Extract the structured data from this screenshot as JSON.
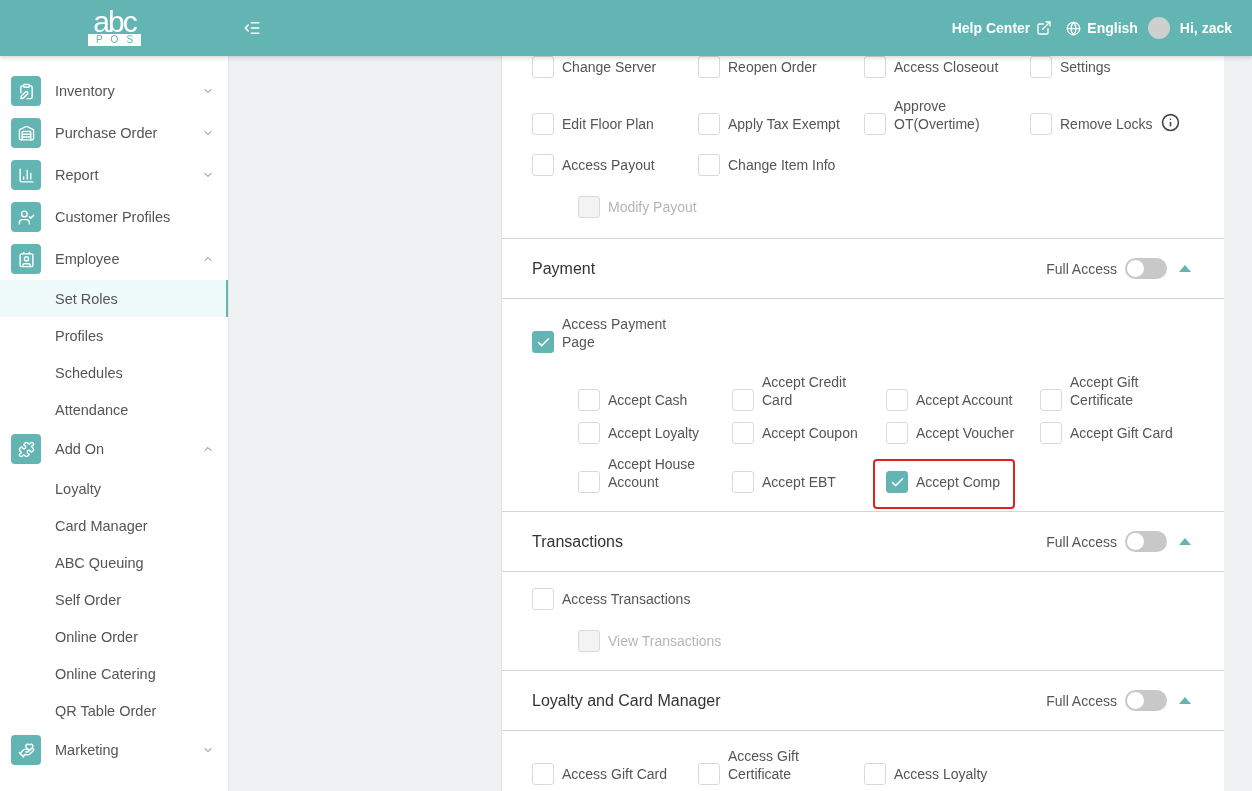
{
  "header": {
    "logo": {
      "wordmark": "abc",
      "sub": "POS"
    },
    "help": "Help Center",
    "language": "English",
    "greeting": "Hi, zack"
  },
  "sidebar": {
    "items": [
      {
        "label": "Inventory",
        "expanded": false
      },
      {
        "label": "Purchase Order",
        "expanded": false
      },
      {
        "label": "Report",
        "expanded": false
      },
      {
        "label": "Customer Profiles"
      },
      {
        "label": "Employee",
        "expanded": true,
        "children": [
          {
            "label": "Set Roles",
            "selected": true
          },
          {
            "label": "Profiles",
            "selected": false
          },
          {
            "label": "Schedules",
            "selected": false
          },
          {
            "label": "Attendance",
            "selected": false
          }
        ]
      },
      {
        "label": "Add On",
        "expanded": true,
        "children": [
          {
            "label": "Loyalty",
            "selected": false
          },
          {
            "label": "Card Manager",
            "selected": false
          },
          {
            "label": "ABC Queuing",
            "selected": false
          },
          {
            "label": "Self Order",
            "selected": false
          },
          {
            "label": "Online Order",
            "selected": false
          },
          {
            "label": "Online Catering",
            "selected": false
          },
          {
            "label": "QR Table Order",
            "selected": false
          }
        ]
      },
      {
        "label": "Marketing",
        "expanded": false
      }
    ]
  },
  "sections": [
    {
      "items": [
        {
          "label": "Change Server",
          "checked": false
        },
        {
          "label": "Reopen Order",
          "checked": false
        },
        {
          "label": "Access Closeout",
          "checked": false
        },
        {
          "label": "Settings",
          "checked": false
        },
        {
          "label": "Edit Floor Plan",
          "checked": false
        },
        {
          "label": "Apply Tax Exempt",
          "checked": false
        },
        {
          "label": "Approve OT(Overtime)",
          "checked": false
        },
        {
          "label": "Remove Locks",
          "checked": false,
          "info": true
        },
        {
          "label": "Access Payout",
          "checked": false,
          "children": [
            {
              "label": "Modify Payout",
              "checked": false,
              "disabled": true
            }
          ]
        },
        {
          "label": "Change Item Info",
          "checked": false
        }
      ]
    },
    {
      "title": "Payment",
      "full_access": {
        "label": "Full Access",
        "on": false
      },
      "expanded": true,
      "items": [
        {
          "label": "Access Payment Page",
          "checked": true,
          "children": [
            {
              "label": "Accept Cash",
              "checked": false,
              "highlighted": false
            },
            {
              "label": "Accept Credit Card",
              "checked": false,
              "highlighted": false
            },
            {
              "label": "Accept Account",
              "checked": false,
              "highlighted": false
            },
            {
              "label": "Accept Gift Certificate",
              "checked": false,
              "highlighted": false
            },
            {
              "label": "Accept Loyalty",
              "checked": false,
              "highlighted": false
            },
            {
              "label": "Accept Coupon",
              "checked": false,
              "highlighted": false
            },
            {
              "label": "Accept Voucher",
              "checked": false,
              "highlighted": false
            },
            {
              "label": "Accept Gift Card",
              "checked": false,
              "highlighted": false
            },
            {
              "label": "Accept House Account",
              "checked": false,
              "highlighted": false
            },
            {
              "label": "Accept EBT",
              "checked": false,
              "highlighted": false
            },
            {
              "label": "Accept Comp",
              "checked": true,
              "highlighted": true
            }
          ]
        }
      ]
    },
    {
      "title": "Transactions",
      "full_access": {
        "label": "Full Access",
        "on": false
      },
      "expanded": true,
      "items": [
        {
          "label": "Access Transactions",
          "checked": false,
          "children": [
            {
              "label": "View Transactions",
              "checked": false,
              "disabled": true
            }
          ]
        }
      ]
    },
    {
      "title": "Loyalty and Card Manager",
      "full_access": {
        "label": "Full Access",
        "on": false
      },
      "expanded": true,
      "items": [
        {
          "label": "Access Gift Card",
          "checked": false
        },
        {
          "label": "Access Gift Certificate",
          "checked": false
        },
        {
          "label": "Access Loyalty",
          "checked": false
        }
      ]
    }
  ]
}
